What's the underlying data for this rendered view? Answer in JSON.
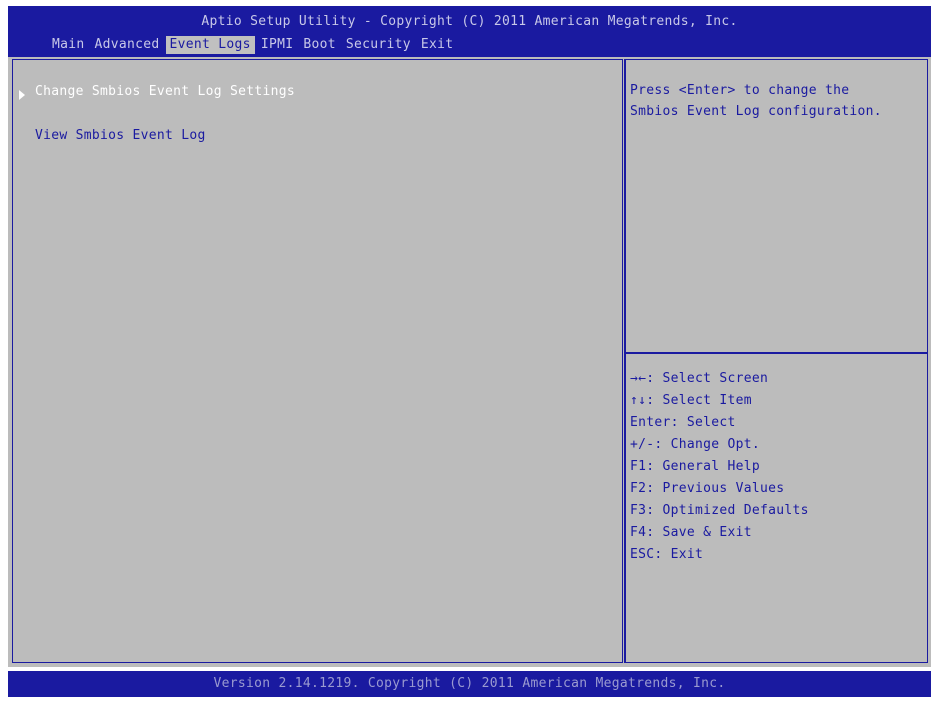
{
  "header": {
    "title": "Aptio Setup Utility - Copyright (C) 2011 American Megatrends, Inc.",
    "tabs": [
      {
        "label": "Main",
        "active": false
      },
      {
        "label": "Advanced",
        "active": false
      },
      {
        "label": "Event Logs",
        "active": true
      },
      {
        "label": "IPMI",
        "active": false
      },
      {
        "label": "Boot",
        "active": false
      },
      {
        "label": "Security",
        "active": false
      },
      {
        "label": "Exit",
        "active": false
      }
    ]
  },
  "main": {
    "items": [
      {
        "label": "Change Smbios Event Log Settings",
        "submenu": true,
        "selected": true
      },
      {
        "label": "View Smbios Event Log",
        "submenu": false,
        "selected": false
      }
    ]
  },
  "help": {
    "description": "Press <Enter> to change the\nSmbios Event Log configuration.",
    "keys": [
      "→←: Select Screen",
      "↑↓: Select Item",
      "Enter: Select",
      "+/-: Change Opt.",
      "F1: General Help",
      "F2: Previous Values",
      "F3: Optimized Defaults",
      "F4: Save & Exit",
      "ESC: Exit"
    ]
  },
  "footer": {
    "text": "Version 2.14.1219. Copyright (C) 2011 American Megatrends, Inc."
  },
  "colors": {
    "header_bg": "#1a1aa0",
    "body_bg": "#bcbcbc",
    "selected_text": "#ffffff",
    "normal_text": "#1a1aa0"
  }
}
